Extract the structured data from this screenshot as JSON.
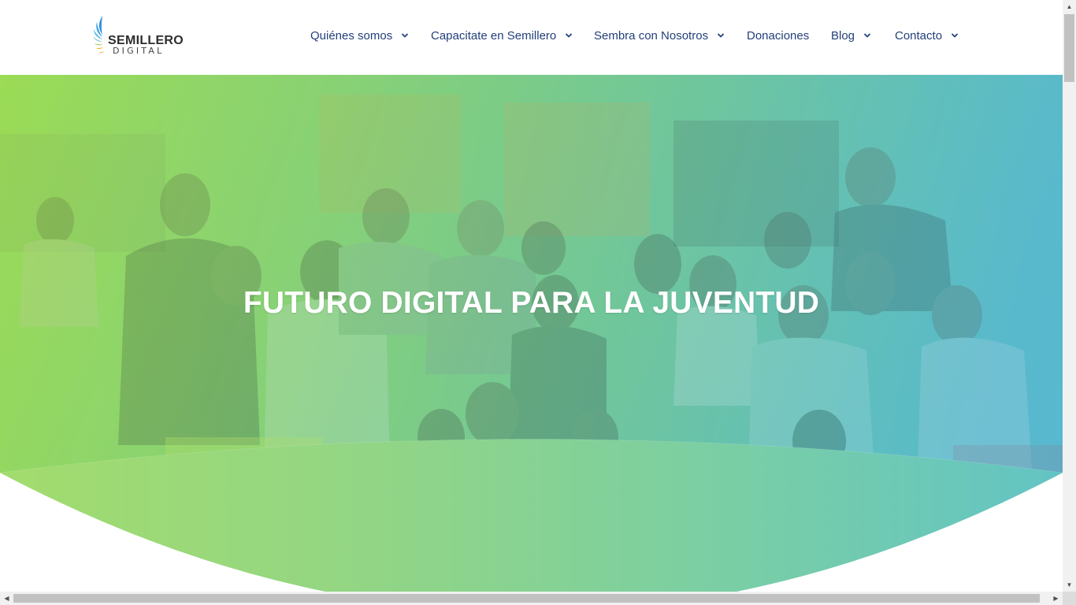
{
  "logo": {
    "name": "SEMILLERO",
    "sub": "DIGITAL"
  },
  "nav": [
    {
      "label": "Quiénes somos",
      "has_dropdown": true
    },
    {
      "label": "Capacitate en Semillero",
      "has_dropdown": true
    },
    {
      "label": "Sembra con Nosotros",
      "has_dropdown": true
    },
    {
      "label": "Donaciones",
      "has_dropdown": false
    },
    {
      "label": "Blog",
      "has_dropdown": true
    },
    {
      "label": "Contacto",
      "has_dropdown": true
    }
  ],
  "hero": {
    "title": "FUTURO DIGITAL PARA LA JUVENTUD"
  },
  "colors": {
    "nav_text": "#23407a",
    "gradient_start": "#9bdb55",
    "gradient_end": "#5ab9cf"
  },
  "icons": {
    "dropdown": "chevron-down-icon",
    "logo_mark": "wing-icon"
  }
}
